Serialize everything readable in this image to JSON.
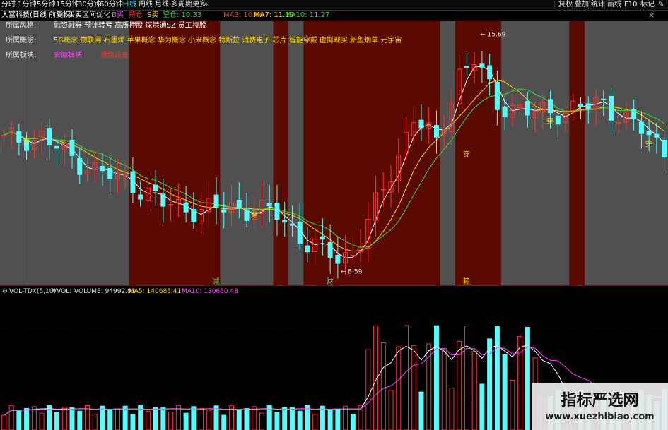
{
  "toolbar": {
    "periods": [
      "分时",
      "1分钟",
      "5分钟",
      "15分钟",
      "30分钟",
      "60分钟",
      "日线",
      "周线",
      "月线",
      "多周期",
      "更多"
    ],
    "active_period": "日线",
    "more_caret": "›",
    "right_items": [
      "复权",
      "叠加",
      "统计",
      "画线",
      "F10",
      "标记"
    ],
    "tool_icon": "✎",
    "close_icon": "×"
  },
  "infobar": {
    "stock_title": "大富科技(日线 前复权)",
    "formula": "买卖区间优化",
    "buy_label": "B买",
    "hold_label": "持仓",
    "sell_label": "S卖",
    "empty_label": "空仓: 10.33",
    "ma3": "MA3: 10.66",
    "ma7": "MA7: 11.19",
    "ma10": "MA10: 11.27"
  },
  "info_rows": [
    {
      "label": "所属风格:",
      "value": "融资融券 预计转亏 高质押股 深港通SZ 员工持股",
      "color": "#ffffff"
    },
    {
      "label": "所属概念:",
      "value": "5G概念 物联网 石墨烯 苹果概念 华为概念 小米概念 特斯拉 消费电子 芯片 智能穿戴 虚拟现实 新型烟草 元宇宙",
      "color": "#ffd700"
    },
    {
      "label": "所属板块:",
      "value": "安徽板块",
      "color": "#ff44ff",
      "extra": "通信设备",
      "extra_color": "#ff3333"
    }
  ],
  "annotations": {
    "high_price": "15.69",
    "low_price": "8.59",
    "pierce": "穿",
    "marks": [
      "减",
      "财",
      "赖"
    ]
  },
  "volume_header": {
    "name": "VOL-TDX(5,10)",
    "vvol": "VVOL: -",
    "volume": "VOLUME: 94992.93",
    "ma5": "MA5: 140685.41",
    "ma10": "MA10: 130650.48"
  },
  "watermark": {
    "title": "指标严选网",
    "url": "www.xuezhibiao.com"
  },
  "colors": {
    "up": "#ff3333",
    "down": "#54ffff",
    "zone_hold": "#5a0a00",
    "zone_empty": "#505050",
    "ma3": "#ffffff",
    "ma7": "#ffd700",
    "ma10": "#33dd33",
    "vol_ma5": "#ffffff",
    "vol_ma10": "#ff44ff"
  }
}
